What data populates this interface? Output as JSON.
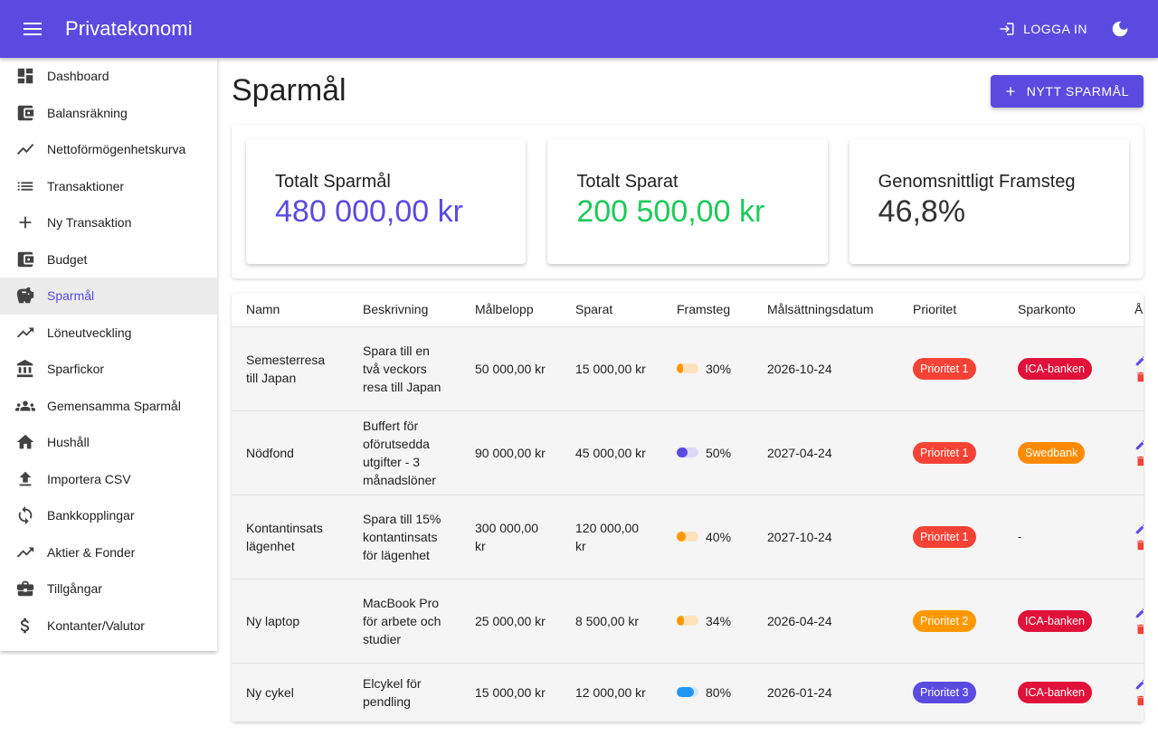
{
  "app": {
    "title": "Privatekonomi",
    "login_label": "LOGGA IN"
  },
  "sidebar": {
    "items": [
      {
        "label": "Dashboard",
        "icon": "dashboard-icon"
      },
      {
        "label": "Balansräkning",
        "icon": "wallet-icon"
      },
      {
        "label": "Nettoförmögenhetskurva",
        "icon": "trend-line-icon"
      },
      {
        "label": "Transaktioner",
        "icon": "list-icon"
      },
      {
        "label": "Ny Transaktion",
        "icon": "plus-icon"
      },
      {
        "label": "Budget",
        "icon": "wallet-icon"
      },
      {
        "label": "Sparmål",
        "icon": "piggy-bank-icon",
        "active": true
      },
      {
        "label": "Löneutveckling",
        "icon": "trending-up-icon"
      },
      {
        "label": "Sparfickor",
        "icon": "bank-icon"
      },
      {
        "label": "Gemensamma Sparmål",
        "icon": "group-icon"
      },
      {
        "label": "Hushåll",
        "icon": "home-icon"
      },
      {
        "label": "Importera CSV",
        "icon": "upload-icon"
      },
      {
        "label": "Bankkopplingar",
        "icon": "bank-sync-icon"
      },
      {
        "label": "Aktier & Fonder",
        "icon": "trending-up-icon"
      },
      {
        "label": "Tillgångar",
        "icon": "briefcase-icon"
      },
      {
        "label": "Kontanter/Valutor",
        "icon": "dollar-icon"
      }
    ]
  },
  "main": {
    "title": "Sparmål",
    "new_button_label": "NYTT SPARMÅL",
    "stats": [
      {
        "label": "Totalt Sparmål",
        "value": "480 000,00 kr",
        "color": "#5b4ae0"
      },
      {
        "label": "Totalt Sparat",
        "value": "200 500,00 kr",
        "color": "#1ec95a"
      },
      {
        "label": "Genomsnittligt Framsteg",
        "value": "46,8%",
        "color": "#333333"
      }
    ],
    "table": {
      "headers": [
        "Namn",
        "Beskrivning",
        "Målbelopp",
        "Sparat",
        "Framsteg",
        "Målsättningsdatum",
        "Prioritet",
        "Sparkonto",
        "Å"
      ],
      "rows": [
        {
          "name": "Semesterresa till Japan",
          "description": "Spara till en två veckors resa till Japan",
          "target": "50 000,00 kr",
          "saved": "15 000,00 kr",
          "progress": 30,
          "progress_label": "30%",
          "progress_color": "#ff9800",
          "date": "2026-10-24",
          "priority": "Prioritet 1",
          "priority_color": "#f44336",
          "account": "ICA-banken",
          "account_color": "#e0113a"
        },
        {
          "name": "Nödfond",
          "description": "Buffert för oförutsedda utgifter - 3 månadslöner",
          "target": "90 000,00 kr",
          "saved": "45 000,00 kr",
          "progress": 50,
          "progress_label": "50%",
          "progress_color": "#5b4ae0",
          "date": "2027-04-24",
          "priority": "Prioritet 1",
          "priority_color": "#f44336",
          "account": "Swedbank",
          "account_color": "#ff8a00"
        },
        {
          "name": "Kontantinsats lägenhet",
          "description": "Spara till 15% kontantinsats för lägenhet",
          "target": "300 000,00 kr",
          "saved": "120 000,00 kr",
          "progress": 40,
          "progress_label": "40%",
          "progress_color": "#ff9800",
          "date": "2027-10-24",
          "priority": "Prioritet 1",
          "priority_color": "#f44336",
          "account": "-",
          "account_color": ""
        },
        {
          "name": "Ny laptop",
          "description": "MacBook Pro för arbete och studier",
          "target": "25 000,00 kr",
          "saved": "8 500,00 kr",
          "progress": 34,
          "progress_label": "34%",
          "progress_color": "#ff9800",
          "date": "2026-04-24",
          "priority": "Prioritet 2",
          "priority_color": "#ff9800",
          "account": "ICA-banken",
          "account_color": "#e0113a"
        },
        {
          "name": "Ny cykel",
          "description": "Elcykel för pendling",
          "target": "15 000,00 kr",
          "saved": "12 000,00 kr",
          "progress": 80,
          "progress_label": "80%",
          "progress_color": "#2196f3",
          "date": "2026-01-24",
          "priority": "Prioritet 3",
          "priority_color": "#5b4ae0",
          "account": "ICA-banken",
          "account_color": "#e0113a"
        }
      ]
    }
  }
}
